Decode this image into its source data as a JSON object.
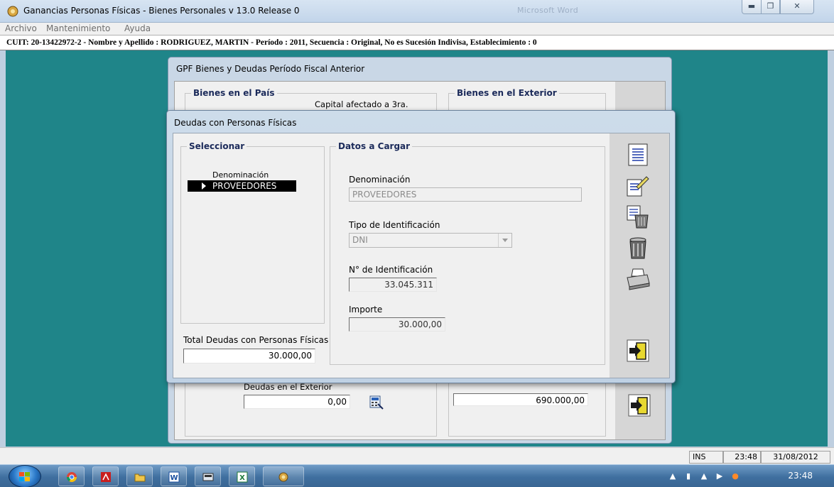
{
  "window": {
    "title": "Ganancias Personas Físicas - Bienes Personales v 13.0 Release 0",
    "ghost_title": "          Microsoft Word"
  },
  "menu": {
    "items": [
      "Archivo",
      "Mantenimiento",
      "Ayuda"
    ]
  },
  "info_bar": "CUIT: 20-13422972-2 -  Nombre y Apellido : RODRIGUEZ, MARTIN -  Período : 2011,  Secuencia : Original, No es Sucesión Indivisa, Establecimiento : 0",
  "background_window": {
    "title": "GPF Bienes y Deudas Período Fiscal Anterior",
    "group_pais": "Bienes en el País",
    "group_exterior": "Bienes en el Exterior",
    "capital_label": "Capital afectado a 3ra.",
    "deudas_exterior_label": "Deudas en el Exterior",
    "deudas_exterior_value": "0,00",
    "right_total_value": "690.000,00"
  },
  "dialog": {
    "title": "Deudas con Personas Físicas",
    "select_group": "Seleccionar",
    "data_group": "Datos a Cargar",
    "grid_header": "Denominación",
    "grid_rows": [
      "PROVEEDORES"
    ],
    "denominacion_label": "Denominación",
    "denominacion_value": "PROVEEDORES",
    "tipo_label": "Tipo de Identificación",
    "tipo_value": "DNI",
    "numero_label": "N° de Identificación",
    "numero_value": "33.045.311",
    "importe_label": "Importe",
    "importe_value": "30.000,00",
    "total_label": "Total Deudas con Personas Físicas",
    "total_value": "30.000,00"
  },
  "statusbar": {
    "mode": "INS",
    "time": "23:48",
    "date": "31/08/2012"
  },
  "taskbar": {
    "clock": "23:48"
  }
}
